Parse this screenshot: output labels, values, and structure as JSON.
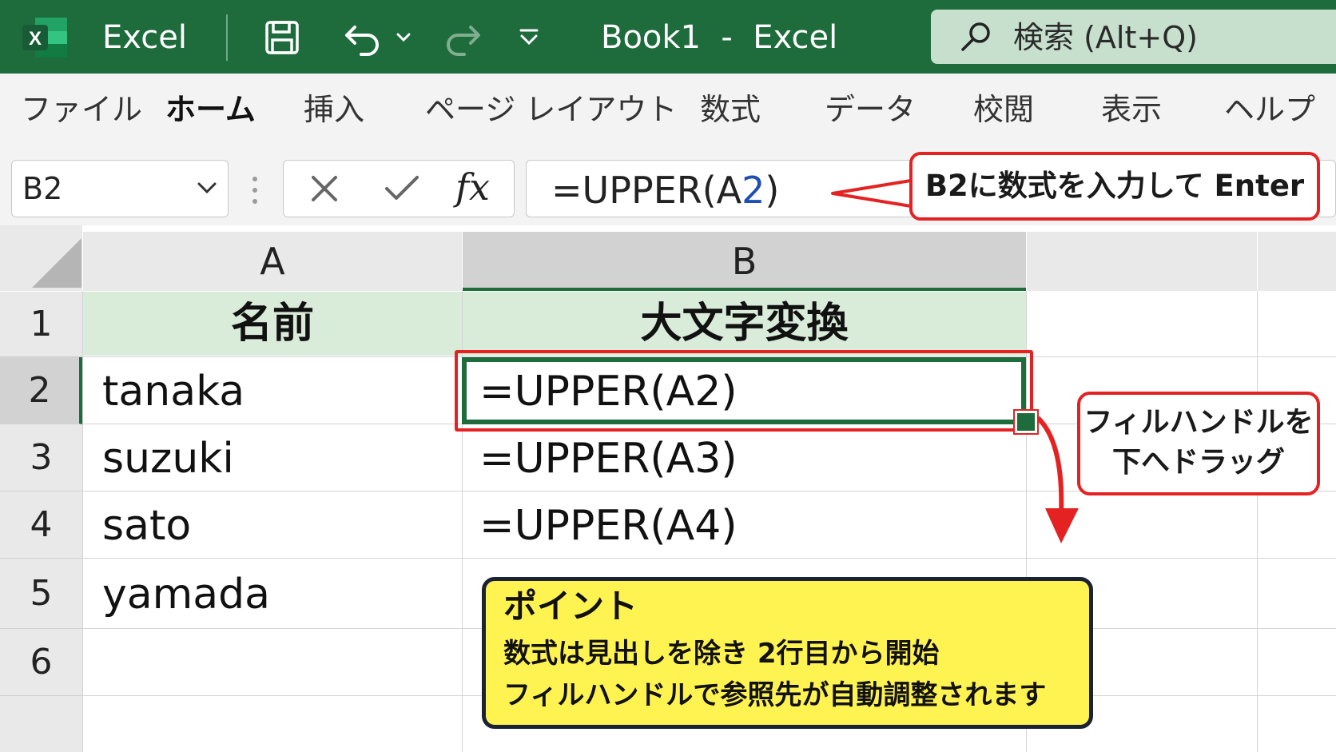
{
  "app": {
    "name": "Excel",
    "document_title": "Book1  -  Excel",
    "search_placeholder": "検索 (Alt+Q)"
  },
  "ribbon": {
    "tabs": [
      {
        "label": "ファイル",
        "active": false
      },
      {
        "label": "ホーム",
        "active": true
      },
      {
        "label": "挿入",
        "active": false
      },
      {
        "label": "ページ レイアウト",
        "active": false
      },
      {
        "label": "数式",
        "active": false
      },
      {
        "label": "データ",
        "active": false
      },
      {
        "label": "校閲",
        "active": false
      },
      {
        "label": "表示",
        "active": false
      },
      {
        "label": "ヘルプ",
        "active": false
      }
    ]
  },
  "formula_bar": {
    "name_box": "B2",
    "fx_label": "fx",
    "formula_prefix": "=UPPER(A",
    "formula_ref": "2",
    "formula_suffix": ")"
  },
  "sheet": {
    "columns": [
      "A",
      "B"
    ],
    "rows": [
      "1",
      "2",
      "3",
      "4",
      "5",
      "6"
    ],
    "header_row": {
      "A": "名前",
      "B": "大文字変換"
    },
    "cells": [
      {
        "A": "tanaka",
        "B": "=UPPER(A2)"
      },
      {
        "A": "suzuki",
        "B": "=UPPER(A3)"
      },
      {
        "A": "sato",
        "B": "=UPPER(A4)"
      },
      {
        "A": "yamada",
        "B": ""
      }
    ],
    "active_cell": "B2"
  },
  "annotations": {
    "formula_callout": "B2に数式を入力して Enter",
    "fill_handle_callout_line1": "フィルハンドルを",
    "fill_handle_callout_line2": "下へドラッグ",
    "point_title": "ポイント",
    "point_line1": "数式は見出しを除き 2行目から開始",
    "point_line2": "フィルハンドルで参照先が自動調整されます"
  },
  "colors": {
    "excel_green": "#1e6b3c",
    "header_fill": "#d9ecd9",
    "callout_red": "#e42222",
    "point_yellow": "#fff351"
  },
  "icons": [
    "excel-logo-icon",
    "save-icon",
    "undo-icon",
    "redo-icon",
    "customize-qat-icon",
    "search-icon",
    "chevron-down-icon",
    "cancel-icon",
    "enter-check-icon"
  ]
}
